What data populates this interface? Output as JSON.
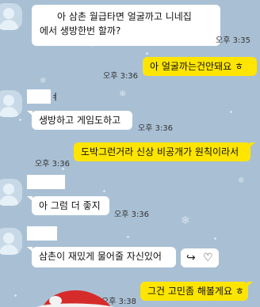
{
  "messages": [
    {
      "id": "m1",
      "side": "in",
      "text": "아 삼촌 월급타면 얼굴까고 니네집\n에서 생방한번 할까?",
      "time": "오후 3:35"
    },
    {
      "id": "m2",
      "side": "out",
      "text": "아 얼굴까는건안돼요 ㅎ",
      "time": "오후 3:36"
    },
    {
      "id": "m3",
      "side": "in",
      "text": "생방하고 게임도하고",
      "time": "오후 3:36"
    },
    {
      "id": "m4",
      "side": "out",
      "text": "도박그런거라 신상 비공개가 원칙이라서",
      "time": "오후 3:36"
    },
    {
      "id": "m5",
      "side": "in",
      "text": "아 그럼 더 좋지",
      "time": "오후 3:36"
    },
    {
      "id": "m6",
      "side": "in",
      "text": "삼촌이 재밌게 물어줄 자신있어",
      "time": ""
    },
    {
      "id": "m7",
      "side": "out",
      "text": "그건 고민좀 해볼게요 ㅎ",
      "time": "오후 3:38"
    }
  ],
  "sender_stub": "ㅕ",
  "icons": {
    "share": "share-arrow-icon",
    "like": "heart-outline-icon"
  },
  "colors": {
    "background": "#a9c0d4",
    "incoming": "#ffffff",
    "outgoing": "#fee500"
  }
}
